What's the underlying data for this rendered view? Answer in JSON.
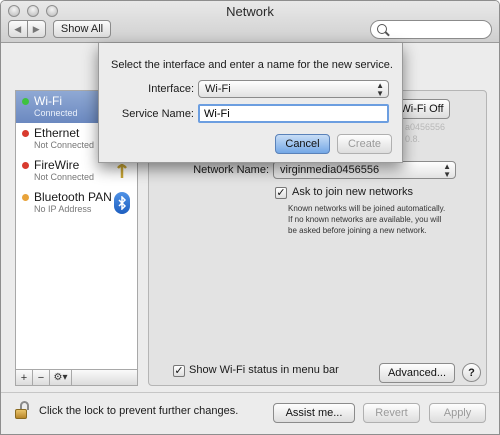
{
  "window": {
    "title": "Network"
  },
  "toolbar": {
    "show_all_label": "Show All",
    "back_icon": "chevron-left-icon",
    "forward_icon": "chevron-right-icon",
    "search_value": ""
  },
  "services": [
    {
      "name": "Wi-Fi",
      "status": "Connected",
      "dot_color": "#3ec23e",
      "selected": true
    },
    {
      "name": "Ethernet",
      "status": "Not Connected",
      "dot_color": "#d83a2e"
    },
    {
      "name": "FireWire",
      "status": "Not Connected",
      "dot_color": "#d83a2e"
    },
    {
      "name": "Bluetooth PAN",
      "status": "No IP Address",
      "dot_color": "#e8a33a"
    }
  ],
  "sidebar_bar": {
    "add": "+",
    "remove": "−",
    "gear": "⚙▾"
  },
  "detail": {
    "wifi_off_label": "Wi-Fi Off",
    "ghost_lines": [
      "a0456556",
      "0.8."
    ],
    "network_name_label": "Network Name:",
    "network_name_value": "virginmedia0456556",
    "ask_join_label": "Ask to join new networks",
    "ask_join_checked": true,
    "ask_join_desc": [
      "Known networks will be joined automatically.",
      "If no known networks are available, you will",
      "be asked before joining a new network."
    ],
    "show_status_label": "Show Wi-Fi status in menu bar",
    "show_status_checked": true,
    "advanced_label": "Advanced...",
    "help_label": "?"
  },
  "footer": {
    "lock_text": "Click the lock to prevent further changes.",
    "assist_label": "Assist me...",
    "revert_label": "Revert",
    "apply_label": "Apply"
  },
  "sheet": {
    "prompt": "Select the interface and enter a name for the new service.",
    "interface_label": "Interface:",
    "interface_value": "Wi-Fi",
    "service_name_label": "Service Name:",
    "service_name_value": "Wi-Fi",
    "cancel_label": "Cancel",
    "create_label": "Create"
  },
  "colors": {
    "accent": "#6c9ee0",
    "selection": "#7a96c8"
  }
}
